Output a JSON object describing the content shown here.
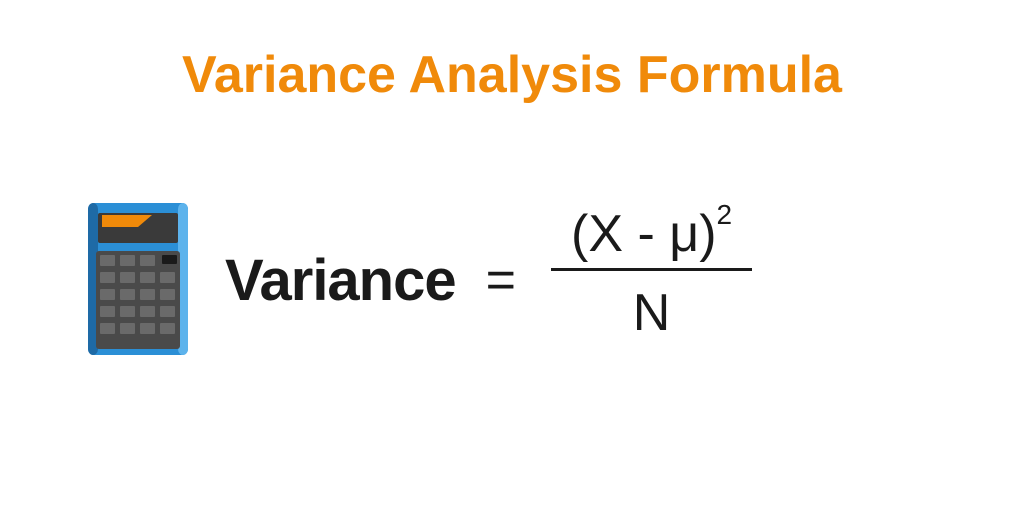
{
  "title": "Variance Analysis Formula",
  "formula": {
    "label": "Variance",
    "equals": "=",
    "numerator_base": "(X - μ)",
    "numerator_exp": "2",
    "denominator": "N"
  },
  "colors": {
    "accent": "#f08a0a",
    "text": "#1a1a1a",
    "calc_body": "#2b8fd6",
    "calc_dark": "#1e6aa6",
    "calc_screen": "#3a3a3a",
    "calc_orange": "#f08a0a"
  }
}
